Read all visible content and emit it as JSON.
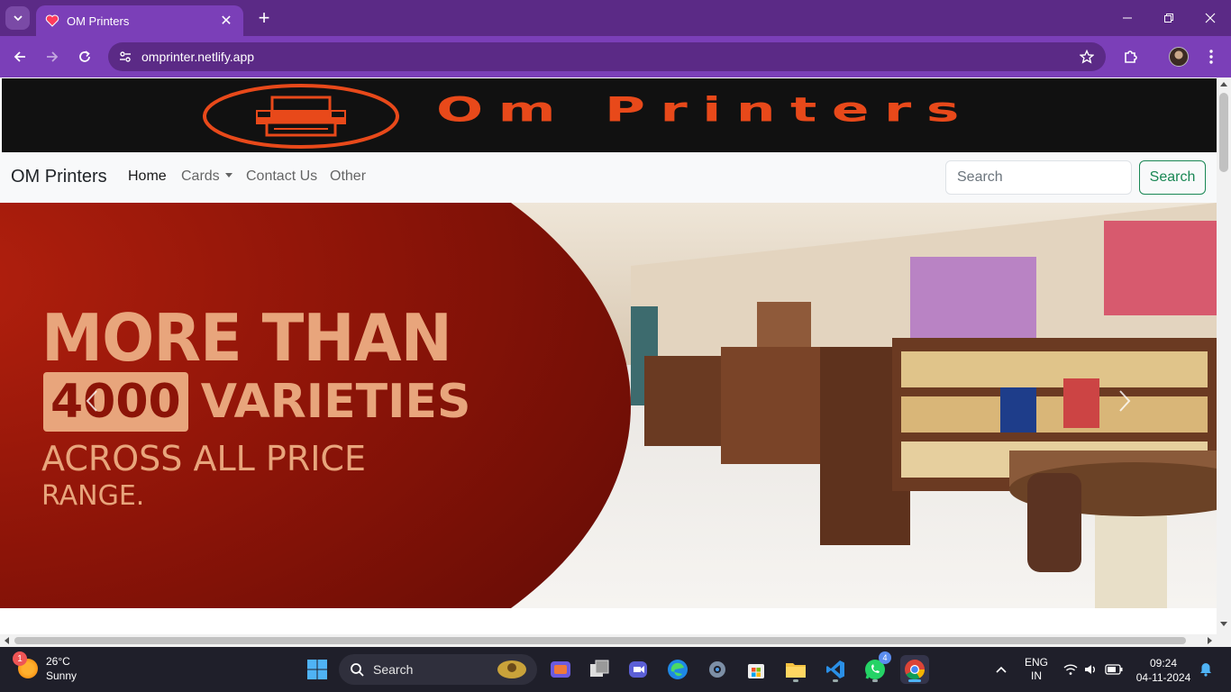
{
  "browser": {
    "tab_title": "OM Printers",
    "url": "omprinter.netlify.app",
    "colors": {
      "tabstrip": "#5b2a86",
      "toolbar": "#7b3fb8"
    }
  },
  "banner": {
    "brand_text": "Om Printers",
    "text_color": "#e8491a"
  },
  "navbar": {
    "brand": "OM Printers",
    "links": [
      "Home",
      "Cards",
      "Contact Us",
      "Other"
    ],
    "search_placeholder": "Search",
    "search_button": "Search"
  },
  "hero": {
    "line1": "MORE THAN",
    "number": "4000",
    "line2": "VARIETIES",
    "line3": "ACROSS ALL PRICE",
    "line4": "RANGE.",
    "text_color": "#e8a57c"
  },
  "taskbar": {
    "weather_temp": "26°C",
    "weather_desc": "Sunny",
    "weather_badge": "1",
    "search_label": "Search",
    "whatsapp_badge": "4",
    "lang_line1": "ENG",
    "lang_line2": "IN",
    "time": "09:24",
    "date": "04-11-2024"
  }
}
